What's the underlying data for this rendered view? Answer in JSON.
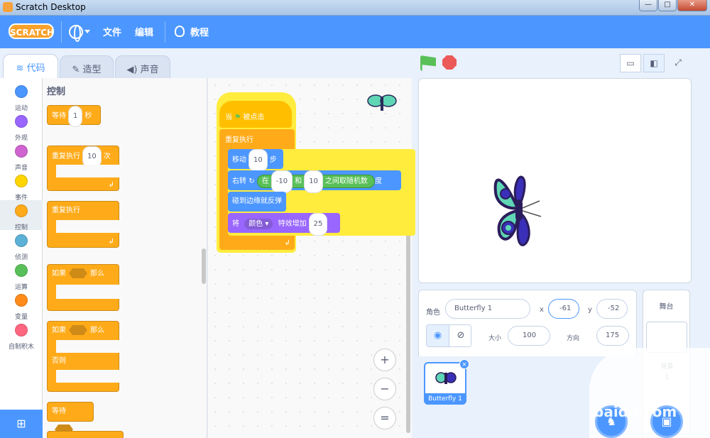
{
  "window": {
    "title": "Scratch Desktop",
    "minimize": "—",
    "maximize": "□",
    "close": "✕"
  },
  "menubar": {
    "logo": "SCRATCH",
    "file": "文件",
    "edit": "编辑",
    "tutorials": "教程"
  },
  "tabs": [
    {
      "label": "代码"
    },
    {
      "label": "造型"
    },
    {
      "label": "声音"
    }
  ],
  "categories": [
    {
      "label": "运动",
      "color": "#4c97ff"
    },
    {
      "label": "外观",
      "color": "#9966ff"
    },
    {
      "label": "声音",
      "color": "#cf63cf"
    },
    {
      "label": "事件",
      "color": "#ffd500"
    },
    {
      "label": "控制",
      "color": "#ffab19"
    },
    {
      "label": "侦测",
      "color": "#5cb1d6"
    },
    {
      "label": "运算",
      "color": "#59c059"
    },
    {
      "label": "变量",
      "color": "#ff8c1a"
    },
    {
      "label": "自制积木",
      "color": "#ff6680"
    }
  ],
  "palette": {
    "title": "控制",
    "wait": {
      "label": "等待",
      "value": "1",
      "unit": "秒"
    },
    "repeat": {
      "label": "重复执行",
      "value": "10",
      "unit": "次"
    },
    "forever": {
      "label": "重复执行"
    },
    "if_then": {
      "label": "如果",
      "then": "那么"
    },
    "if_else": {
      "label": "如果",
      "then": "那么",
      "else": "否则"
    },
    "wait_until": {
      "label": "等待"
    }
  },
  "script": {
    "hat": {
      "label": "当",
      "suffix": "被点击"
    },
    "forever": "重复执行",
    "move": {
      "label": "移动",
      "value": "10",
      "unit": "步"
    },
    "turn": {
      "label": "右转",
      "in": "在",
      "from": "-10",
      "and": "和",
      "to": "10",
      "random": "之间取随机数",
      "unit": "度"
    },
    "bounce": "碰到边缘就反弹",
    "effect": {
      "label": "将",
      "effect": "颜色 ▾",
      "change": "特效增加",
      "value": "25"
    }
  },
  "zoom": {
    "in": "+",
    "out": "−",
    "reset": "="
  },
  "sprite_info": {
    "sprite_label": "角色",
    "sprite_name": "Butterfly 1",
    "x_label": "x",
    "x": "-61",
    "y_label": "y",
    "y": "-52",
    "size_label": "大小",
    "size": "100",
    "direction_label": "方向",
    "direction": "175"
  },
  "sprite_thumb": {
    "name": "Butterfly 1",
    "delete": "×"
  },
  "stage_pane": {
    "title": "舞台",
    "backdrop_label": "背景",
    "backdrop_count": "1"
  },
  "watermark": "baidu.com"
}
